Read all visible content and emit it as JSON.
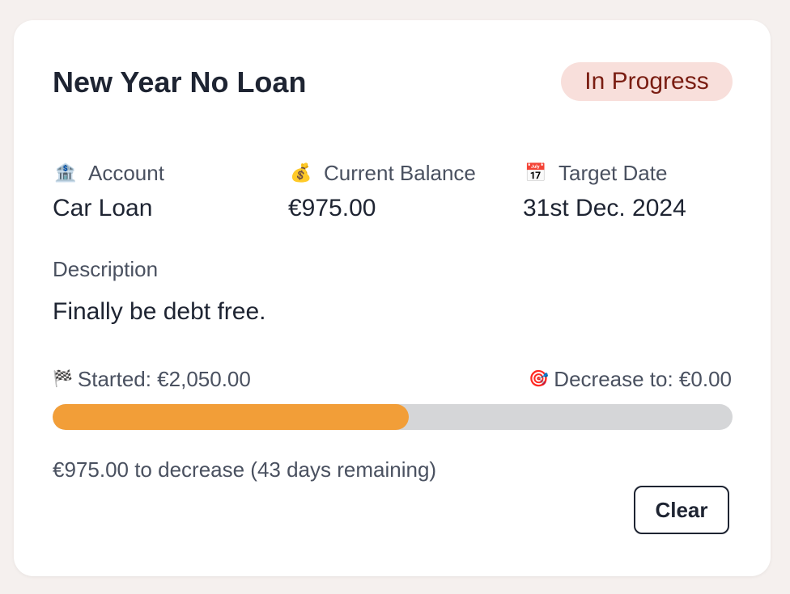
{
  "goal": {
    "title": "New Year No Loan",
    "status": "In Progress",
    "status_color": "#7a1d12",
    "status_bg": "#f8dfdb",
    "account": {
      "icon": "bank-icon",
      "glyph": "🏦",
      "label": "Account",
      "value": "Car Loan"
    },
    "balance": {
      "icon": "money-bag-icon",
      "glyph": "💰",
      "label": "Current Balance",
      "value": "€975.00"
    },
    "target_date": {
      "icon": "calendar-icon",
      "glyph": "📅",
      "label": "Target Date",
      "value": "31st Dec. 2024"
    },
    "description": {
      "label": "Description",
      "value": "Finally be debt free."
    },
    "progress": {
      "started_icon": "checkered-flag-icon",
      "started_glyph": "🏁",
      "started_text": "Started: €2,050.00",
      "target_icon": "target-icon",
      "target_glyph": "🎯",
      "target_text": "Decrease to: €0.00",
      "fraction": 0.524,
      "fill_color": "#f29e38",
      "track_color": "#d5d6d8"
    },
    "remaining_text": "€975.00 to decrease (43 days remaining)",
    "clear_label": "Clear"
  }
}
